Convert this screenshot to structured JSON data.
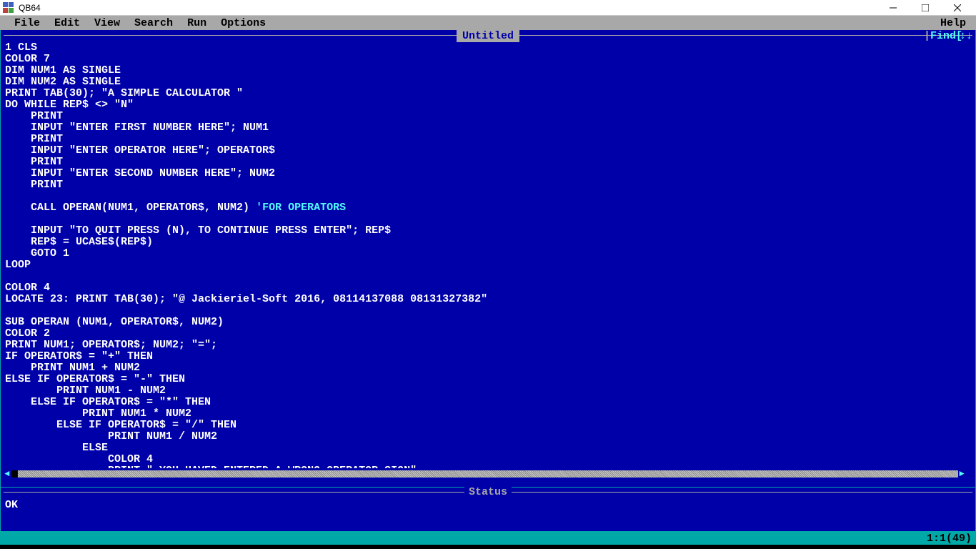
{
  "titlebar": {
    "app_name": "QB64"
  },
  "menubar": {
    "items": [
      "File",
      "Edit",
      "View",
      "Search",
      "Run",
      "Options"
    ],
    "right": "Help"
  },
  "editor": {
    "title": "Untitled",
    "find_label": "Find",
    "arrows": "↕↓"
  },
  "code": [
    {
      "t": "1 CLS"
    },
    {
      "t": "COLOR 7"
    },
    {
      "t": "DIM NUM1 AS SINGLE"
    },
    {
      "t": "DIM NUM2 AS SINGLE"
    },
    {
      "t": "PRINT TAB(30); \"A SIMPLE CALCULATOR \""
    },
    {
      "t": "DO WHILE REP$ <> \"N\""
    },
    {
      "t": "    PRINT"
    },
    {
      "t": "    INPUT \"ENTER FIRST NUMBER HERE\"; NUM1"
    },
    {
      "t": "    PRINT"
    },
    {
      "t": "    INPUT \"ENTER OPERATOR HERE\"; OPERATOR$"
    },
    {
      "t": "    PRINT"
    },
    {
      "t": "    INPUT \"ENTER SECOND NUMBER HERE\"; NUM2"
    },
    {
      "t": "    PRINT"
    },
    {
      "t": ""
    },
    {
      "t": "    CALL OPERAN(NUM1, OPERATOR$, NUM2) ",
      "c": "'FOR OPERATORS"
    },
    {
      "t": ""
    },
    {
      "t": "    INPUT \"TO QUIT PRESS (N), TO CONTINUE PRESS ENTER\"; REP$"
    },
    {
      "t": "    REP$ = UCASE$(REP$)"
    },
    {
      "t": "    GOTO 1"
    },
    {
      "t": "LOOP"
    },
    {
      "t": ""
    },
    {
      "t": "COLOR 4"
    },
    {
      "t": "LOCATE 23: PRINT TAB(30); \"@ Jackieriel-Soft 2016, 08114137088 08131327382\""
    },
    {
      "t": ""
    },
    {
      "t": "SUB OPERAN (NUM1, OPERATOR$, NUM2)"
    },
    {
      "t": "COLOR 2"
    },
    {
      "t": "PRINT NUM1; OPERATOR$; NUM2; \"=\";"
    },
    {
      "t": "IF OPERATOR$ = \"+\" THEN"
    },
    {
      "t": "    PRINT NUM1 + NUM2"
    },
    {
      "t": "ELSE IF OPERATOR$ = \"-\" THEN"
    },
    {
      "t": "        PRINT NUM1 - NUM2"
    },
    {
      "t": "    ELSE IF OPERATOR$ = \"*\" THEN"
    },
    {
      "t": "            PRINT NUM1 * NUM2"
    },
    {
      "t": "        ELSE IF OPERATOR$ = \"/\" THEN"
    },
    {
      "t": "                PRINT NUM1 / NUM2"
    },
    {
      "t": "            ELSE"
    },
    {
      "t": "                COLOR 4"
    },
    {
      "t": "                PRINT \" YOU HAVED ENTERED A WRONG OPERATOR SIGN\""
    }
  ],
  "status": {
    "label": "Status",
    "text": "OK"
  },
  "bottom": {
    "position": "1:1(49)"
  }
}
